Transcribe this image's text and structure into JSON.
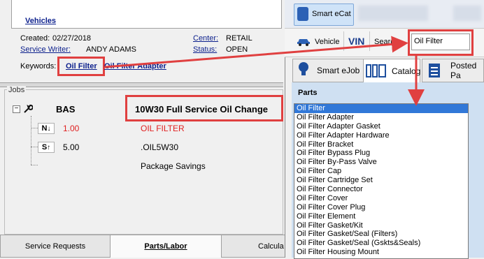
{
  "left": {
    "vehicles_link": "Vehicles",
    "created_label": "Created:",
    "created_value": "02/27/2018",
    "writer_label": "Service Writer:",
    "writer_value": "ANDY ADAMS",
    "center_label": "Center:",
    "center_value": "RETAIL",
    "status_label": "Status:",
    "status_value": "OPEN",
    "keywords_label": "Keywords:",
    "keyword1": "Oil Filter",
    "keyword2": "Oil Filter Adapter"
  },
  "jobs": {
    "legend": "Jobs",
    "job_code": "BAS",
    "job_title": "10W30 Full Service Oil Change",
    "lines": [
      {
        "badge": "N",
        "qty": "1.00",
        "desc": "OIL FILTER",
        "color": "#e02020"
      },
      {
        "badge": "S",
        "qty": "5.00",
        "desc": ".OIL5W30",
        "color": "#000000"
      },
      {
        "badge": "",
        "qty": "",
        "desc": "Package Savings",
        "color": "#000000"
      }
    ]
  },
  "bottom_tabs": [
    "Service Requests",
    "Parts/Labor",
    "Calcula"
  ],
  "right": {
    "smart_ecat": "Smart eCat",
    "blurred_tab": "ACI AUTO Connect",
    "vehicle_btn": "Vehicle",
    "vin_btn": "VIN",
    "search_label": "Search",
    "search_value": "Oil Filter",
    "tabs": [
      "Smart eJob",
      "Catalog",
      "Posted Pa"
    ],
    "parts_header": "Parts",
    "parts": [
      "Oil Filter",
      "Oil Filter Adapter",
      "Oil Filter Adapter Gasket",
      "Oil Filter Adapter Hardware",
      "Oil Filter Bracket",
      "Oil Filter Bypass Plug",
      "Oil Filter By-Pass Valve",
      "Oil Filter Cap",
      "Oil Filter Cartridge Set",
      "Oil Filter Connector",
      "Oil Filter Cover",
      "Oil Filter Cover Plug",
      "Oil Filter Element",
      "Oil Filter Gasket/Kit",
      "Oil Filter Gasket/Seal (Filters)",
      "Oil Filter Gasket/Seal (Gskts&Seals)",
      "Oil Filter Housing Mount"
    ]
  },
  "colors": {
    "highlight": "#e04040",
    "link": "#0b1f8c",
    "selection": "#3178d8"
  }
}
